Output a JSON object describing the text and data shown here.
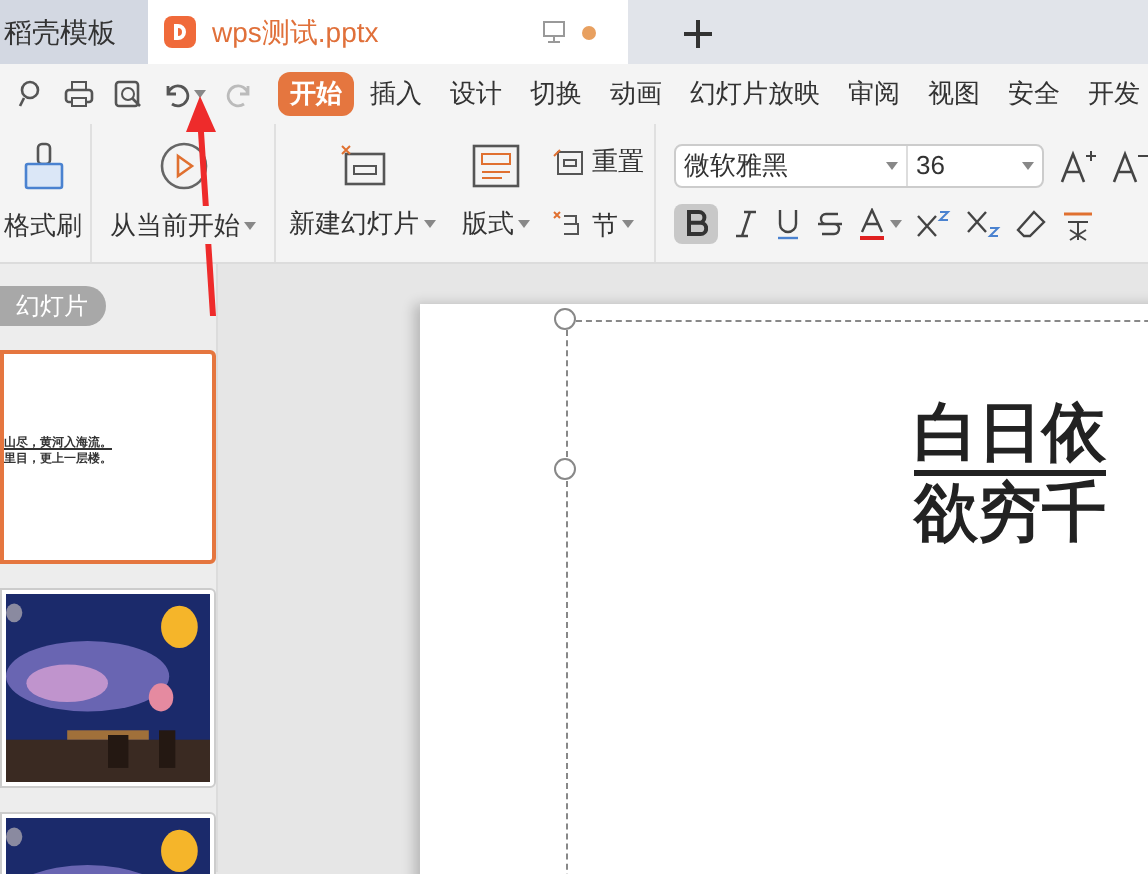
{
  "tabs": [
    {
      "label": "稻壳模板",
      "selected": false,
      "kind": "doc"
    },
    {
      "label": "wps测试.pptx",
      "selected": true,
      "kind": "file"
    }
  ],
  "menu": [
    {
      "label": "开始",
      "selected": true
    },
    {
      "label": "插入",
      "selected": false
    },
    {
      "label": "设计",
      "selected": false
    },
    {
      "label": "切换",
      "selected": false
    },
    {
      "label": "动画",
      "selected": false
    },
    {
      "label": "幻灯片放映",
      "selected": false
    },
    {
      "label": "审阅",
      "selected": false
    },
    {
      "label": "视图",
      "selected": false
    },
    {
      "label": "安全",
      "selected": false
    },
    {
      "label": "开发",
      "selected": false
    }
  ],
  "ribbon": {
    "format_painter": "格式刷",
    "play_from_current": "从当前开始",
    "new_slide": "新建幻灯片",
    "layout": "版式",
    "reset": "重置",
    "section": "节",
    "font": "微软雅黑",
    "size": "36",
    "bold_active": true
  },
  "panel": {
    "title": "幻灯片",
    "slides": [
      {
        "kind": "text",
        "selected": true,
        "lines": [
          "山尽，黄河入海流。",
          "里目，更上一层楼。"
        ]
      },
      {
        "kind": "picture",
        "selected": false
      },
      {
        "kind": "picture",
        "selected": false
      }
    ]
  },
  "slide": {
    "lines": [
      "白日依",
      "欲穷千"
    ]
  }
}
